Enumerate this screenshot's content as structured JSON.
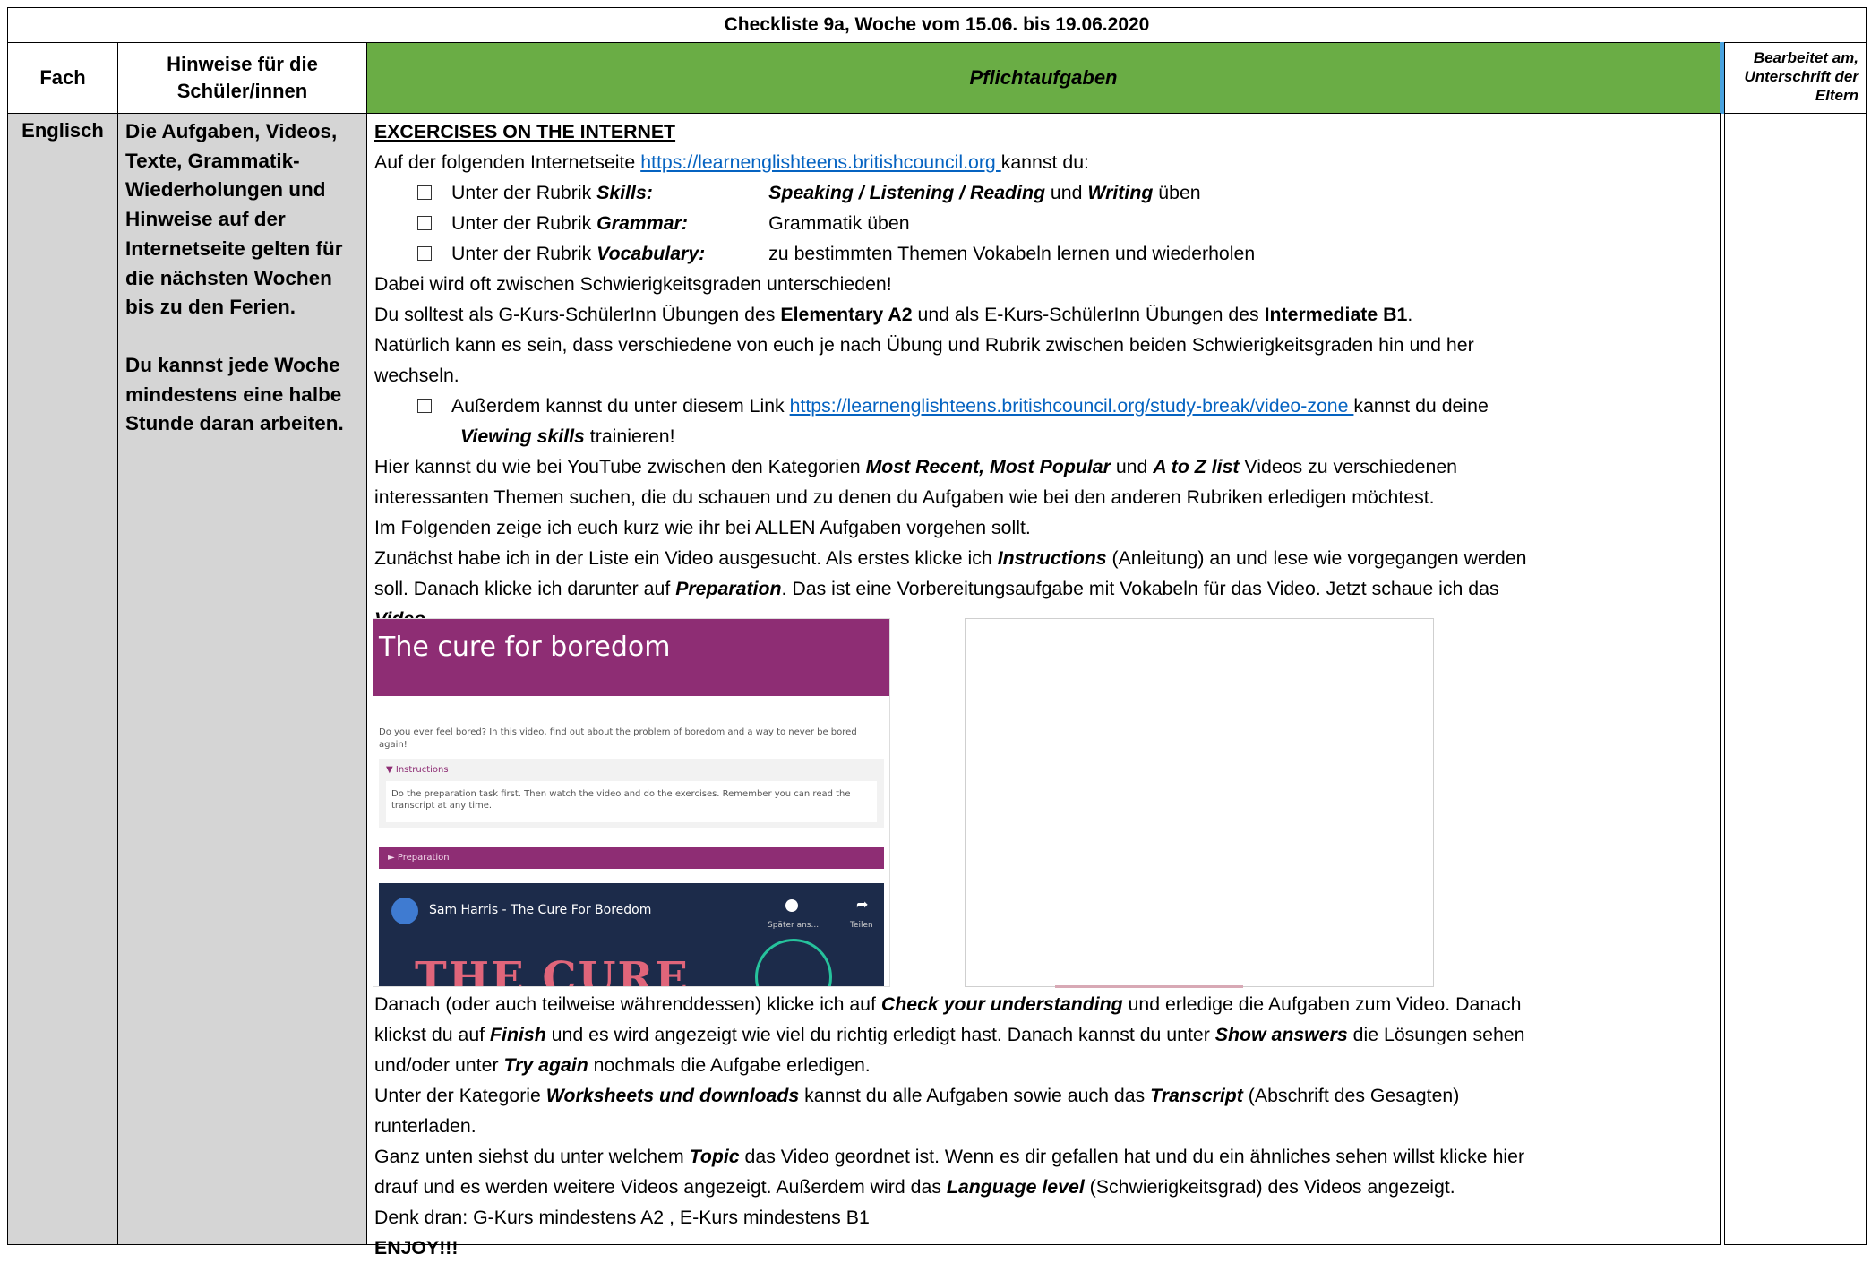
{
  "title": "Checkliste 9a, Woche vom 15.06. bis 19.06.2020",
  "headers": {
    "fach": "Fach",
    "hinweise": "Hinweise für die Schüler/innen",
    "pflicht": "Pflichtaufgaben",
    "bearbeitet": "Bearbeitet am, Unterschrift der Eltern"
  },
  "row": {
    "fach": "Englisch",
    "hinweise_1": "Die Aufgaben, Videos, Texte, Grammatik-Wiederholungen und Hinweise auf der Internetseite gelten für die nächsten Wochen bis zu den Ferien.",
    "hinweise_2": "Du kannst jede Woche mindestens eine halbe Stunde daran arbeiten."
  },
  "content": {
    "heading": "EXCERCISES ON THE INTERNET",
    "intro_pre": "Auf der folgenden Internetseite ",
    "url1": "https://learnenglishteens.britishcouncil.org ",
    "intro_post": "kannst du:",
    "b1_pre": "Unter der Rubrik ",
    "b1_label": "Skills:",
    "b1_items": "Speaking / Listening / Reading",
    "b1_und": " und ",
    "b1_writing": "Writing",
    "b1_post": " üben",
    "b2_pre": "Unter der Rubrik ",
    "b2_label": "Grammar:",
    "b2_post": "Grammatik üben",
    "b3_pre": "Unter der Rubrik ",
    "b3_label": "Vocabulary:",
    "b3_post": "zu bestimmten Themen Vokabeln lernen und wiederholen",
    "p_diff": "Dabei wird oft zwischen Schwierigkeitsgraden unterschieden!",
    "p_sollst_1": "Du solltest als G-Kurs-SchülerInn Übungen des ",
    "p_sollst_a2": "Elementary A2",
    "p_sollst_2": " und als E-Kurs-SchülerInn Übungen des ",
    "p_sollst_b1": "Intermediate B1",
    "p_sollst_3": ".",
    "p_nat_1": "Natürlich kann es sein, dass verschiedene von euch je nach Übung und Rubrik zwischen beiden Schwierigkeitsgraden hin und her",
    "p_nat_2": "wechseln.",
    "b4_pre": "Außerdem kannst du unter diesem Link ",
    "url2": "https://learnenglishteens.britishcouncil.org/study-break/video-zone ",
    "b4_post": "kannst du deine",
    "b4_label": "Viewing skills",
    "b4_end": " trainieren!",
    "p_yt_1": "Hier kannst du wie bei YouTube zwischen den Kategorien ",
    "p_yt_cats": "Most Recent, Most Popular",
    "p_yt_und": " und ",
    "p_yt_az": "A to Z list",
    "p_yt_2": " Videos zu verschiedenen",
    "p_yt_3": "interessanten Themen suchen, die du schauen und zu denen du Aufgaben wie bei den anderen Rubriken erledigen möchtest.",
    "p_folg": "Im Folgenden zeige ich euch kurz wie ihr bei ALLEN Aufgaben vorgehen sollt.",
    "p_zun_1": "Zunächst habe ich in der Liste ein Video ausgesucht. Als erstes klicke ich ",
    "p_zun_instr": "Instructions",
    "p_zun_2": " (Anleitung) an und lese wie vorgegangen werden",
    "p_zun_3": "soll. Danach klicke ich darunter auf ",
    "p_zun_prep": "Preparation",
    "p_zun_4": ". Das ist eine Vorbereitungsaufgabe mit Vokabeln für das Video. Jetzt schaue ich das",
    "p_zun_video": "Video",
    "p_zun_5": ".",
    "p_dan_1": "Danach (oder auch teilweise währenddessen) klicke ich auf ",
    "p_dan_check": "Check your understanding",
    "p_dan_2": " und erledige die Aufgaben zum Video. Danach",
    "p_dan_3": "klickst du auf ",
    "p_dan_finish": "Finish",
    "p_dan_4": " und es wird angezeigt wie viel du richtig erledigt hast. Danach kannst du unter ",
    "p_dan_show": "Show answers",
    "p_dan_5": " die Lösungen sehen",
    "p_dan_6": "und/oder unter ",
    "p_dan_try": "Try again",
    "p_dan_7": " nochmals die Aufgabe erledigen.",
    "p_ws_1": "Unter der Kategorie ",
    "p_ws_label": "Worksheets und downloads",
    "p_ws_2": " kannst du alle Aufgaben sowie auch das ",
    "p_ws_trans": "Transcript",
    "p_ws_3": " (Abschrift des Gesagten)",
    "p_ws_4": "runterladen.",
    "p_gu_1": "Ganz unten siehst du unter welchem ",
    "p_gu_topic": "Topic",
    "p_gu_2": " das Video geordnet ist. Wenn es dir gefallen hat und du ein ähnliches sehen willst klicke hier",
    "p_gu_3": "drauf und es werden weitere Videos angezeigt. Außerdem wird das ",
    "p_gu_lang": "Language level",
    "p_gu_4": " (Schwierigkeitsgrad) des Videos angezeigt.",
    "p_denk": "Denk dran: G-Kurs mindestens A2 , E-Kurs mindestens B1",
    "p_enjoy": "ENJOY!!!"
  },
  "screenshot": {
    "title": "The cure for boredom",
    "desc": "Do you ever feel bored? In this video, find out about the problem of boredom and a way to never be bored again!",
    "instr_label": "▼ Instructions",
    "instr_text": "Do the preparation task first. Then watch the video and do the exercises. Remember you can read the transcript at any time.",
    "prep_label": "► Preparation",
    "video_title": "Sam Harris - The Cure For Boredom",
    "video_later": "Später ans...",
    "video_share": "Teilen",
    "video_overlay": "THE CURE"
  },
  "colors": {
    "header_green": "#6aad45",
    "fach_grey": "#d5d5d5",
    "link_blue": "#0563c1",
    "purple": "#8e2d74"
  }
}
